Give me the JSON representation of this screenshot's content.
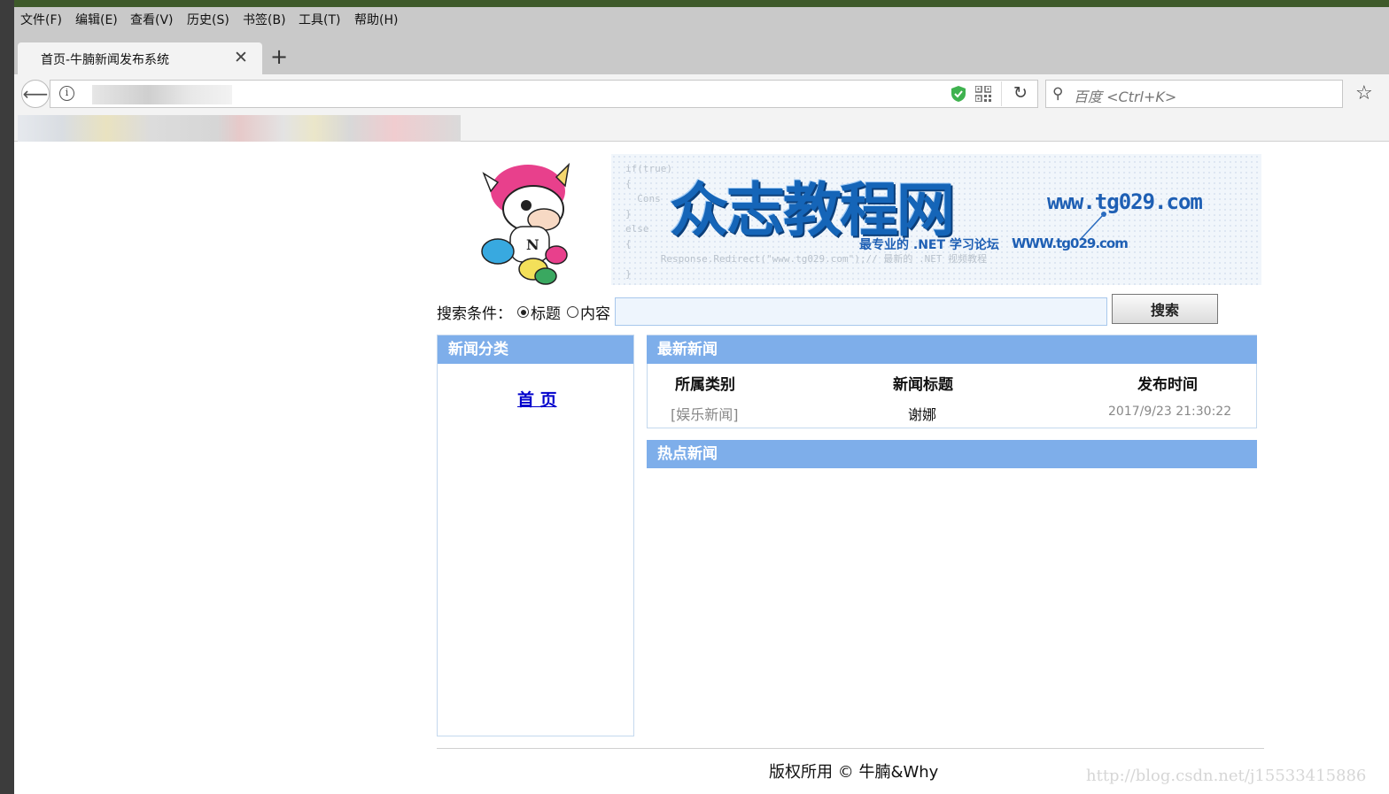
{
  "browser": {
    "menu": [
      "文件(F)",
      "编辑(E)",
      "查看(V)",
      "历史(S)",
      "书签(B)",
      "工具(T)",
      "帮助(H)"
    ],
    "tab_title": "首页-牛腩新闻发布系统",
    "close_symbol": "✕",
    "new_tab_symbol": "+",
    "back_symbol": "⟵",
    "reload_symbol": "↻",
    "search_placeholder": "百度 <Ctrl+K>",
    "star_symbol": "☆",
    "info_symbol": "i",
    "magnifier_symbol": "⚲"
  },
  "banner": {
    "code_lines": [
      "if(true)",
      "{",
      "Cons",
      "}",
      "else",
      "{",
      "Response.Redirect(\"www.tg029.com\");// 最新的 .NET 视频教程",
      "}"
    ],
    "brand": "众志教程网",
    "url": "www.tg029.com",
    "slogan": "最专业的 .NET 学习论坛",
    "slogan_url": "WWW.tg029.com"
  },
  "search": {
    "label": "搜索条件：",
    "option_title": "标题",
    "option_content": "内容",
    "selected": "标题",
    "input_value": "",
    "button": "搜索"
  },
  "category_panel": {
    "title": "新闻分类",
    "links": [
      "首 页"
    ]
  },
  "latest_news": {
    "title": "最新新闻",
    "columns": [
      "所属类别",
      "新闻标题",
      "发布时间"
    ],
    "rows": [
      {
        "category": "[娱乐新闻]",
        "title": "谢娜",
        "time": "2017/9/23 21:30:22"
      }
    ]
  },
  "hot_news": {
    "title": "热点新闻"
  },
  "footer": {
    "copyright": "版权所用 © 牛腩&Why"
  },
  "watermark": "http://blog.csdn.net/j15533415886",
  "colors": {
    "panel_header": "#7eaeea",
    "link": "#0000cc",
    "banner_blue": "#1565b8"
  }
}
